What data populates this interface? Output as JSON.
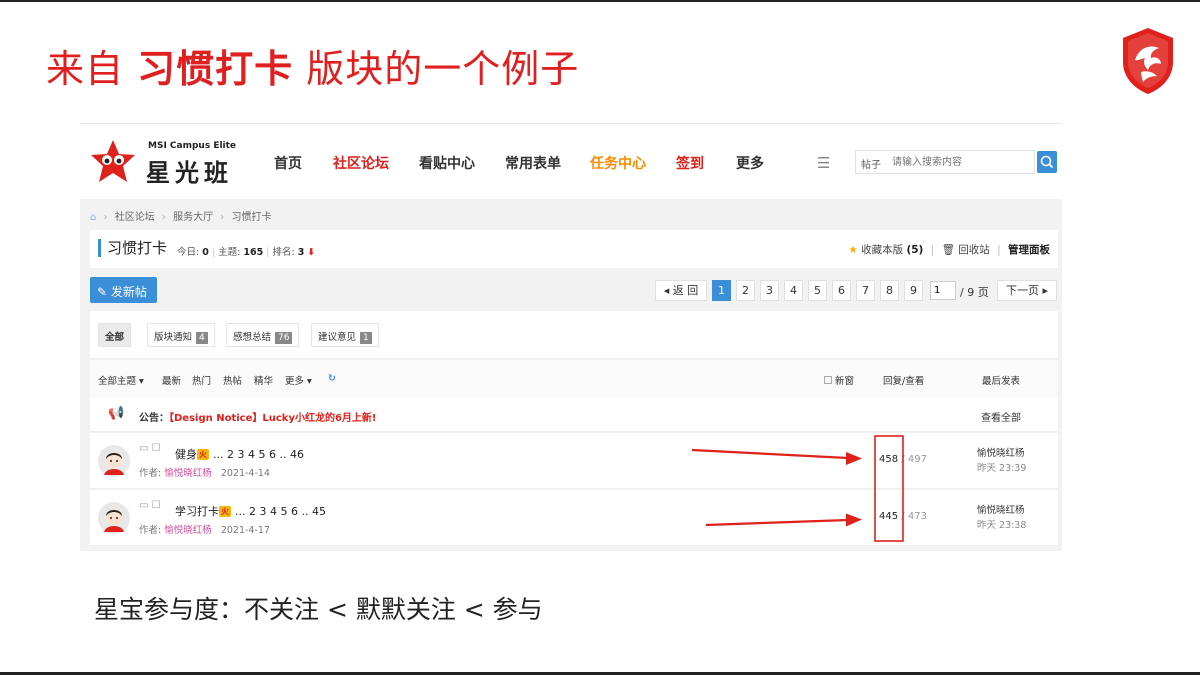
{
  "slide": {
    "title_pre": "来自 ",
    "title_bold": "习惯打卡",
    "title_post": " 版块的一个例子",
    "caption": "星宝参与度：不关注 < 默默关注 < 参与"
  },
  "logo": {
    "icon": "msi-dragon-shield-icon",
    "color": "#e0201b"
  },
  "header": {
    "brand_en": "MSI Campus Elite",
    "brand_cn": "星光班",
    "nav": [
      "首页",
      "社区论坛",
      "看贴中心",
      "常用表单",
      "任务中心",
      "签到",
      "更多"
    ],
    "search_category": "帖子",
    "search_placeholder": "请输入搜索内容"
  },
  "breadcrumb": [
    "社区论坛",
    "服务大厅",
    "习惯打卡"
  ],
  "forum": {
    "name": "习惯打卡",
    "today_label": "今日:",
    "today_value": "0",
    "topics_label": "主题:",
    "topics_value": "165",
    "rank_label": "排名:",
    "rank_value": "3",
    "favorite_label": "收藏本版",
    "favorite_count": "(5)",
    "recycle_label": "回收站",
    "admin_label": "管理面板"
  },
  "toolbar": {
    "new_post": "发新帖",
    "back": "◂ 返 回",
    "pages": [
      "1",
      "2",
      "3",
      "4",
      "5",
      "6",
      "7",
      "8",
      "9"
    ],
    "current_page": "1",
    "total_pages": "/ 9 页",
    "next": "下一页 ▸"
  },
  "filter_tabs": [
    {
      "label": "全部",
      "count": ""
    },
    {
      "label": "版块通知",
      "count": "4"
    },
    {
      "label": "感想总结",
      "count": "76"
    },
    {
      "label": "建议意见",
      "count": "1"
    }
  ],
  "sort_bar": {
    "all_topics": "全部主题 ▾",
    "latest": "最新",
    "hot": "热门",
    "hot_posts": "热帖",
    "digest": "精华",
    "more": "更多 ▾",
    "new_window": "新窗",
    "reply_view": "回复/查看",
    "last_post": "最后发表"
  },
  "notice": {
    "prefix": "公告：",
    "text": "【Design Notice】Lucky小红龙的6月上新!",
    "view_all": "查看全部"
  },
  "threads": [
    {
      "title": "健身",
      "badge": "火",
      "pages": "... 2 3 4 5 6 .. 46",
      "author_label": "作者:",
      "author": "愉悦晓红杨",
      "date": "2021-4-14",
      "replies": "458",
      "views": "497",
      "last_user": "愉悦晓红杨",
      "last_time": "昨天 23:39"
    },
    {
      "title": "学习打卡",
      "badge": "火",
      "pages": "... 2 3 4 5 6 .. 45",
      "author_label": "作者:",
      "author": "愉悦晓红杨",
      "date": "2021-4-17",
      "replies": "445",
      "views": "473",
      "last_user": "愉悦晓红杨",
      "last_time": "昨天 23:38"
    }
  ],
  "colors": {
    "accent": "#3a8fd8",
    "brand_red": "#e0201b",
    "task_orange": "#ff8a00"
  }
}
